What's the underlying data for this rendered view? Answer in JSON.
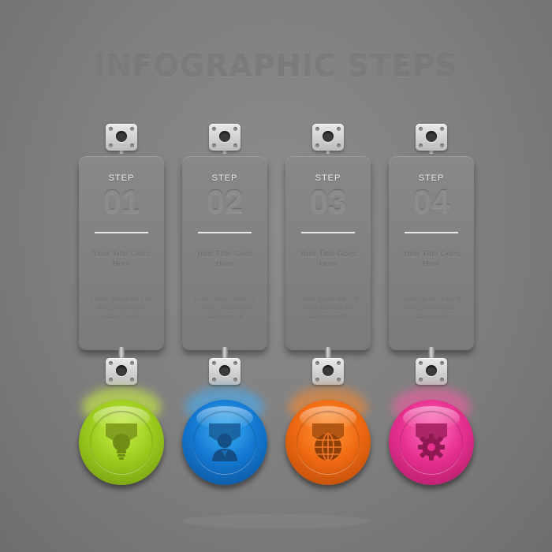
{
  "title": "INFOGRAPHIC STEPS",
  "steps": [
    {
      "label": "STEP",
      "number": "01",
      "heading": "Your Title Goes Here",
      "body": "Lorem ipsum dolor sit amet, consectetur adipiscing elit",
      "color": "#9ccc1d",
      "icon": "lightbulb-icon"
    },
    {
      "label": "STEP",
      "number": "02",
      "heading": "Your Title Goes Here",
      "body": "Lorem ipsum dolor sit amet, consectetur adipiscing elit",
      "color": "#1479d2",
      "icon": "user-icon"
    },
    {
      "label": "STEP",
      "number": "03",
      "heading": "Your Title Goes Here",
      "body": "Lorem ipsum dolor sit amet, consectetur adipiscing elit",
      "color": "#f06a12",
      "icon": "globe-icon"
    },
    {
      "label": "STEP",
      "number": "04",
      "heading": "Your Title Goes Here",
      "body": "Lorem ipsum dolor sit amet, consectetur adipiscing elit",
      "color": "#e7308f",
      "icon": "gear-icon"
    }
  ]
}
